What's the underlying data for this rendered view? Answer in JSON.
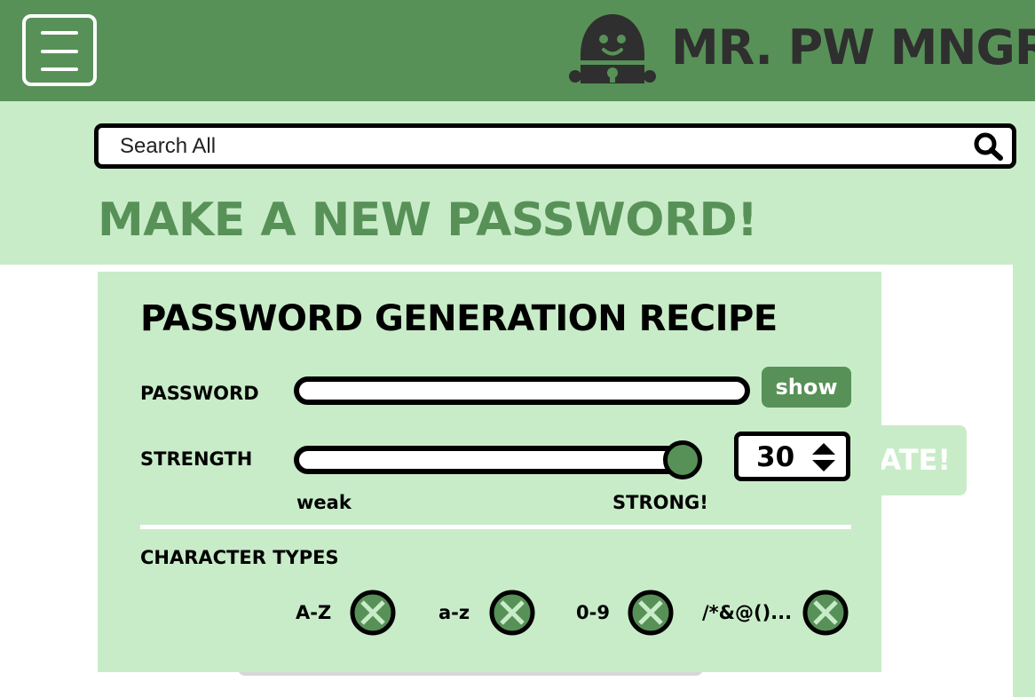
{
  "header": {
    "brand": "MR. PW MNGR",
    "menu_icon": "hamburger-menu-icon",
    "logo_icon": "padlock-mascot-icon"
  },
  "search": {
    "placeholder": "Search All",
    "icon": "search-icon"
  },
  "page_title": "MAKE A NEW PASSWORD!",
  "background": {
    "generate_button_partial": "ATE!"
  },
  "recipe": {
    "title": "PASSWORD GENERATION RECIPE",
    "password_label": "PASSWORD",
    "password_value": "",
    "show_label": "show",
    "strength_label": "STRENGTH",
    "strength_value": "30",
    "strength_fraction": 1.0,
    "weak_label": "weak",
    "strong_label": "STRONG!",
    "character_types_label": "CHARACTER TYPES",
    "character_types": [
      {
        "label": "A-Z",
        "icon": "checkbox-x-icon"
      },
      {
        "label": "a-z",
        "icon": "checkbox-x-icon"
      },
      {
        "label": "0-9",
        "icon": "checkbox-x-icon"
      },
      {
        "label": "/*&@()...",
        "icon": "checkbox-x-icon"
      }
    ]
  },
  "colors": {
    "header_green": "#579157",
    "light_green": "#c8ecc8",
    "dark": "#2f2f2f"
  }
}
